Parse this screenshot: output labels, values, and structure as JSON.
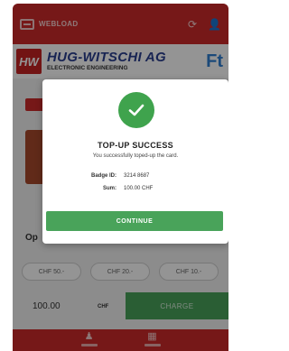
{
  "app_bar": {
    "title": "WEBLOAD",
    "refresh_icon": "refresh-icon",
    "user_icon": "user-icon"
  },
  "brand": {
    "badge_text": "HW",
    "company_name": "HUG-WITSCHI AG",
    "company_tagline": "ELECTRONIC ENGINEERING",
    "right_logo_text": "Ft"
  },
  "options": {
    "title": "Op",
    "chips": [
      "CHF 50.-",
      "CHF 20.-",
      "CHF 10.-"
    ]
  },
  "charge": {
    "amount": "100.00",
    "currency": "CHF",
    "button_label": "CHARGE"
  },
  "modal": {
    "icon": "check-icon",
    "title": "TOP-UP SUCCESS",
    "message": "You successfully toped-up the card.",
    "badge_label": "Badge ID:",
    "badge_value": "3214 8687",
    "sum_label": "Sum:",
    "sum_value": "100.00 CHF",
    "continue_label": "CONTINUE"
  },
  "colors": {
    "brand_red": "#cc2a2a",
    "success_green": "#3fa34d",
    "button_green": "#49a35a"
  }
}
